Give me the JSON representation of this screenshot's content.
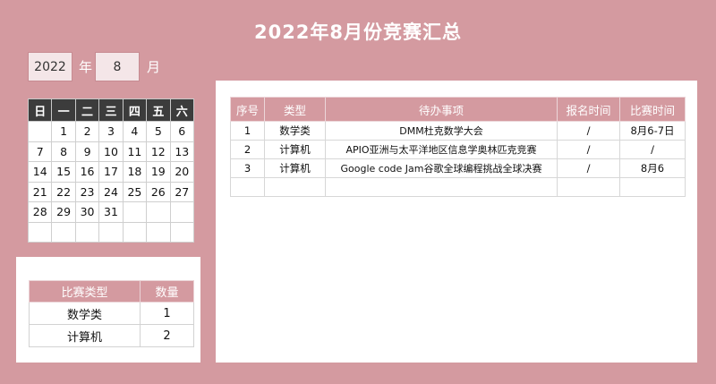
{
  "title": "2022年8月份竞赛汇总",
  "selector": {
    "year": "2022",
    "year_label": "年",
    "month": "8",
    "month_label": "月"
  },
  "calendar": {
    "weekdays": [
      "日",
      "一",
      "二",
      "三",
      "四",
      "五",
      "六"
    ],
    "weeks": [
      [
        "",
        "1",
        "2",
        "3",
        "4",
        "5",
        "6"
      ],
      [
        "7",
        "8",
        "9",
        "10",
        "11",
        "12",
        "13"
      ],
      [
        "14",
        "15",
        "16",
        "17",
        "18",
        "19",
        "20"
      ],
      [
        "21",
        "22",
        "23",
        "24",
        "25",
        "26",
        "27"
      ],
      [
        "28",
        "29",
        "30",
        "31",
        "",
        "",
        ""
      ],
      [
        "",
        "",
        "",
        "",
        "",
        "",
        ""
      ]
    ]
  },
  "summary": {
    "headers": [
      "比赛类型",
      "数量"
    ],
    "rows": [
      [
        "数学类",
        "1"
      ],
      [
        "计算机",
        "2"
      ]
    ]
  },
  "events": {
    "headers": [
      "序号",
      "类型",
      "待办事项",
      "报名时间",
      "比赛时间"
    ],
    "rows": [
      [
        "1",
        "数学类",
        "DMM杜克数学大会",
        "/",
        "8月6-7日"
      ],
      [
        "2",
        "计算机",
        "APIO亚洲与太平洋地区信息学奥林匹克竞赛",
        "/",
        "/"
      ],
      [
        "3",
        "计算机",
        "Google code Jam谷歌全球编程挑战全球决赛",
        "/",
        "8月6"
      ],
      [
        "",
        "",
        "",
        "",
        ""
      ]
    ]
  }
}
